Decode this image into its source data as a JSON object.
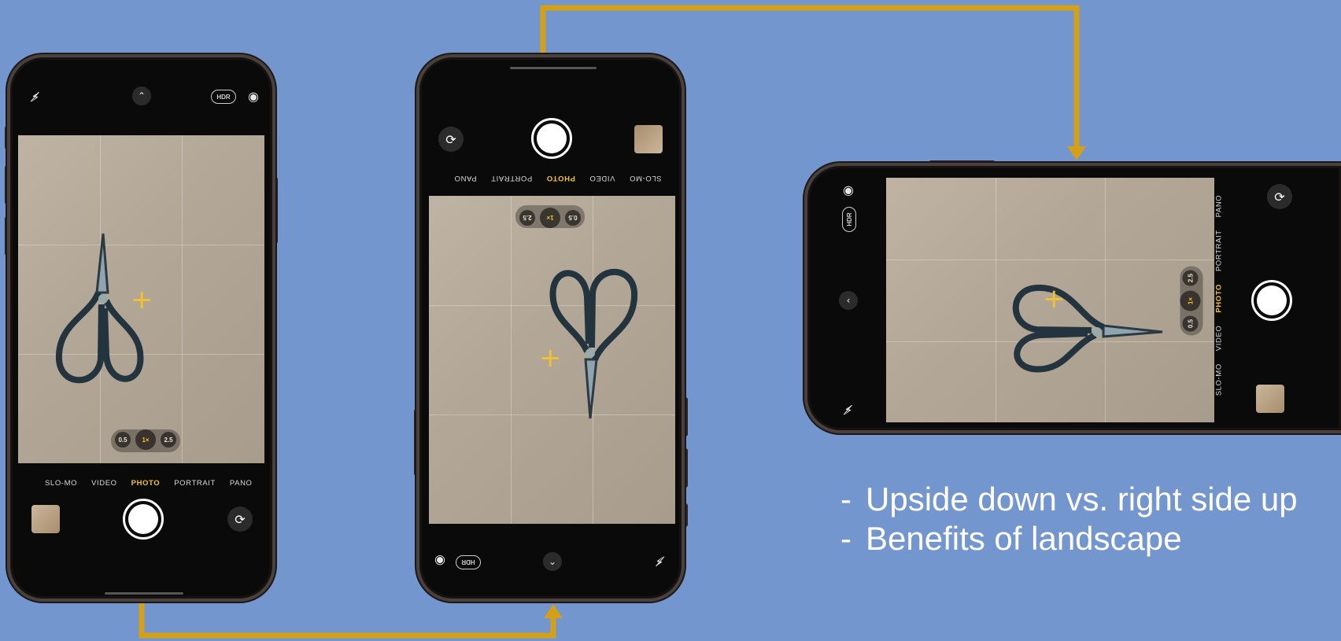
{
  "colors": {
    "background": "#7496cf",
    "arrow": "#d4a017",
    "accent_yellow": "#f1c232"
  },
  "phone1": {
    "modes": [
      "SLO-MO",
      "VIDEO",
      "PHOTO",
      "PORTRAIT",
      "PANO"
    ],
    "selected_mode": "PHOTO",
    "zoom": [
      "0.5",
      "1×",
      "2.5"
    ],
    "hdr_label": "HDR",
    "icons": [
      "flash-off-icon",
      "chevron-up-icon",
      "live-photo-icon",
      "camera-flip-icon"
    ]
  },
  "phone2": {
    "modes": [
      "SLO-MO",
      "VIDEO",
      "PHOTO",
      "PORTRAIT",
      "PANO"
    ],
    "selected_mode": "PHOTO",
    "zoom": [
      "0.5",
      "1×",
      "2.5"
    ],
    "hdr_label": "HDR"
  },
  "phone3": {
    "modes": [
      "SLO-MO",
      "VIDEO",
      "PHOTO",
      "PORTRAIT",
      "PANO"
    ],
    "selected_mode": "PHOTO",
    "zoom": [
      "0.5",
      "1×",
      "2.5"
    ],
    "hdr_label": "HDR"
  },
  "bullets": [
    {
      "dash": "-",
      "text": "Upside down vs. right side up"
    },
    {
      "dash": "-",
      "text": "Benefits of landscape"
    }
  ]
}
